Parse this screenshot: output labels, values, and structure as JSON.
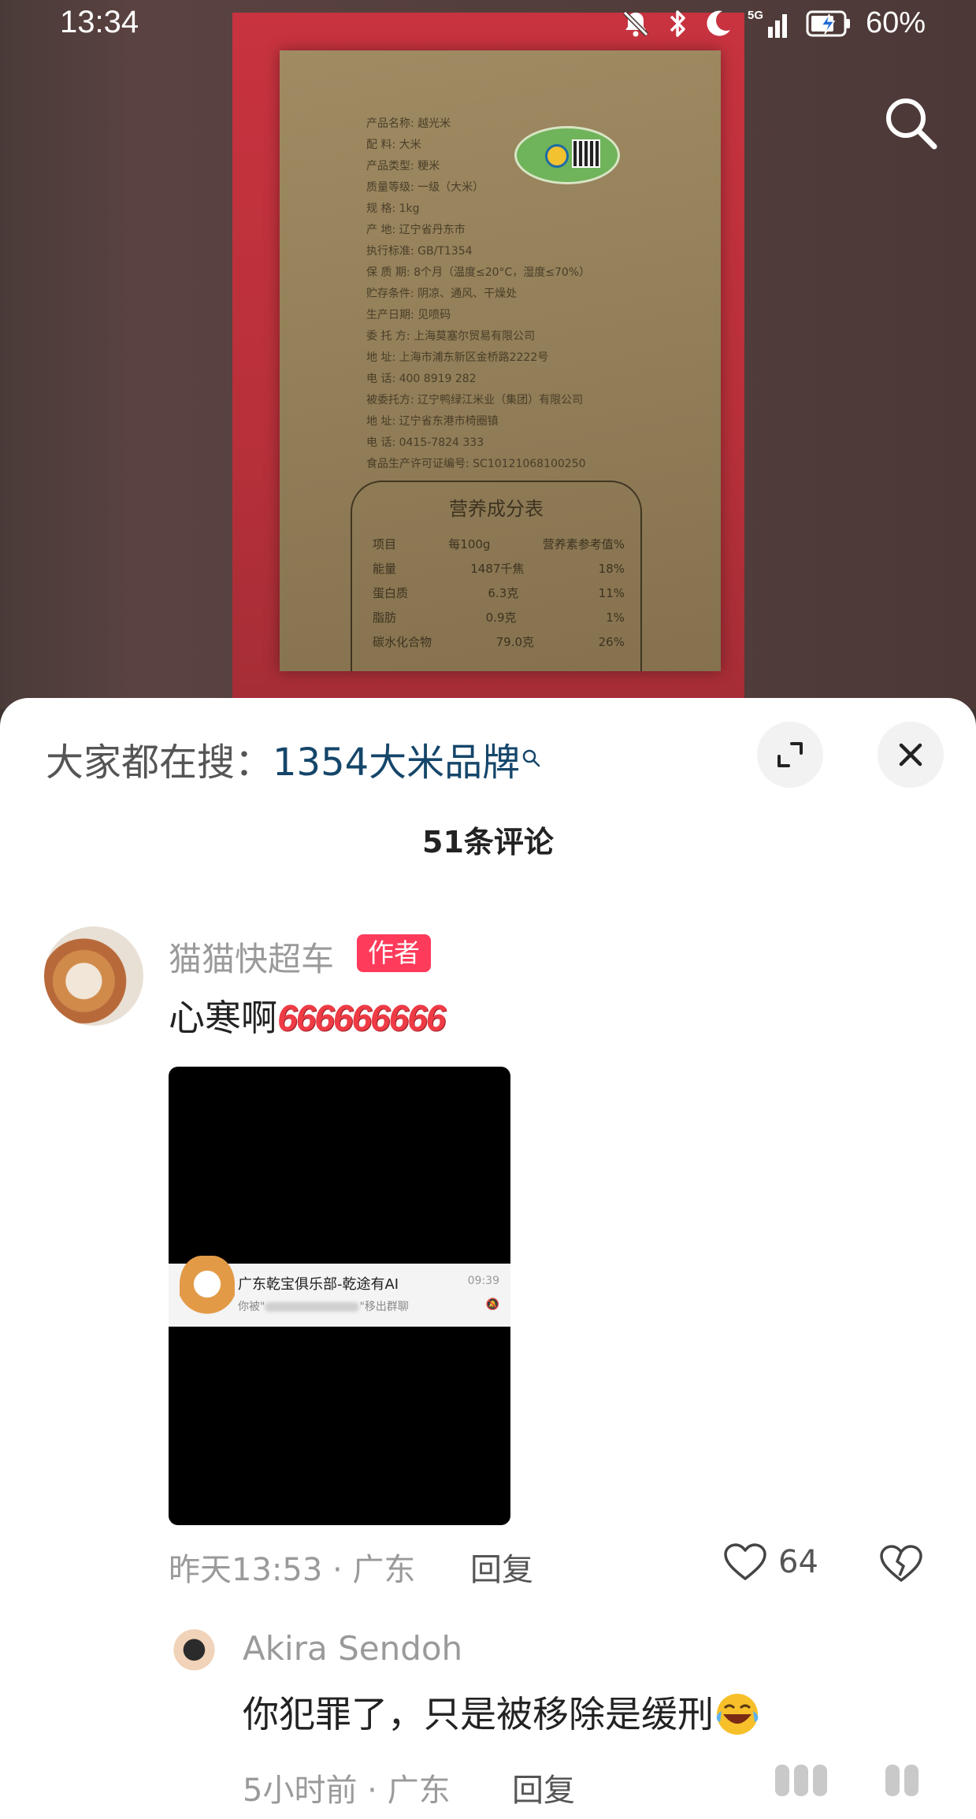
{
  "status_bar": {
    "time": "13:34",
    "network": "5G",
    "battery": "60%"
  },
  "video": {
    "label_lines": [
      "产品名称:  越光米",
      "配    料:  大米",
      "产品类型:  粳米",
      "质量等级:  一级（大米）",
      "规    格:  1kg",
      "产    地:  辽宁省丹东市",
      "执行标准:  GB/T1354",
      "保 质 期:  8个月（温度≤20°C，湿度≤70%）",
      "贮存条件:  阴凉、通风、干燥处",
      "生产日期:  见喷码",
      "委 托 方:  上海莫塞尔贸易有限公司",
      "地    址:  上海市浦东新区金桥路2222号",
      "电    话:  400 8919 282",
      "被委托方:  辽宁鸭绿江米业（集团）有限公司",
      "地    址:  辽宁省东港市椅圈镇",
      "电    话:  0415-7824 333",
      "食品生产许可证编号:  SC10121068100250"
    ],
    "nutrition_title": "营养成分表",
    "nutrition_rows": [
      [
        "项目",
        "每100g",
        "营养素参考值%"
      ],
      [
        "能量",
        "1487千焦",
        "18%"
      ],
      [
        "蛋白质",
        "6.3克",
        "11%"
      ],
      [
        "脂肪",
        "0.9克",
        "1%"
      ],
      [
        "碳水化合物",
        "79.0克",
        "26%"
      ]
    ]
  },
  "sheet": {
    "hot_search_prefix": "大家都在搜：",
    "hot_search_query": "1354大米品牌",
    "comment_count": "51条评论",
    "comment1": {
      "user": "猫猫快超车",
      "badge": "作者",
      "text": "心寒啊",
      "emoji_text": "666666666",
      "image": {
        "title": "广东乾宝俱乐部-乾途有AI",
        "time": "09:39",
        "body_prefix": "你被\"",
        "body_suffix": "\"移出群聊"
      },
      "time_location": "昨天13:53 · 广东",
      "reply": "回复",
      "likes": "64"
    },
    "comment2": {
      "user": "Akira Sendoh",
      "text": "你犯罪了，只是被移除是缓刑",
      "time_location": "5小时前 · 广东",
      "reply": "回复"
    }
  },
  "colors": {
    "accent_red": "#fe3b5a",
    "hot_query": "#15466a"
  },
  "icons": [
    "mute-icon",
    "bluetooth-icon",
    "moon-icon",
    "signal-icon",
    "battery-icon",
    "search-icon",
    "expand-icon",
    "close-icon",
    "heart-icon",
    "broken-heart-icon",
    "laughing-emoji-icon"
  ]
}
